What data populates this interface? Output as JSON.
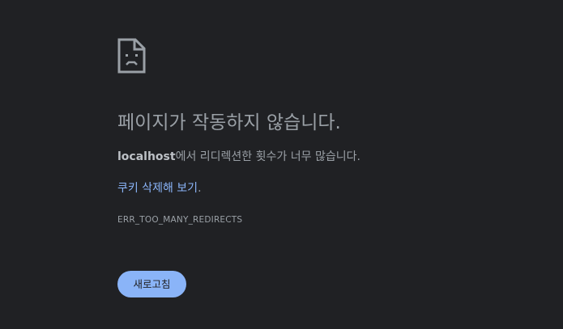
{
  "icon": "sad-page-icon",
  "title": "페이지가 작동하지 않습니다.",
  "description": {
    "host": "localhost",
    "message": "에서 리디렉션한 횟수가 너무 많습니다."
  },
  "clear_cookies": {
    "link_text": "쿠키 삭제해 보기",
    "suffix": "."
  },
  "error_code": "ERR_TOO_MANY_REDIRECTS",
  "reload_button": "새로고침",
  "colors": {
    "background": "#202124",
    "text": "#9aa0a6",
    "link": "#8ab4f8",
    "button_bg": "#8ab4f8",
    "button_text": "#202124"
  }
}
